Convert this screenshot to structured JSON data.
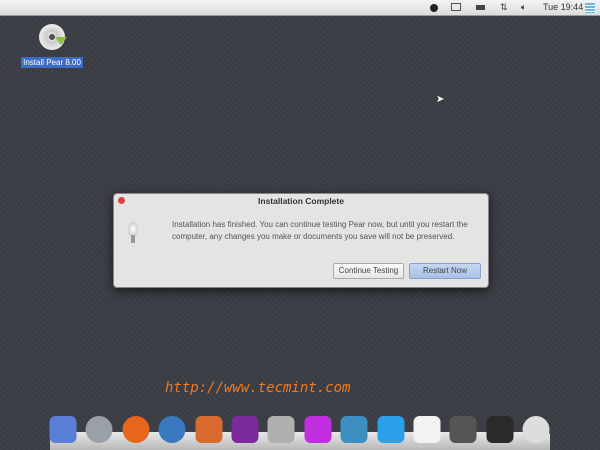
{
  "menubar": {
    "apple": "",
    "clock": "Tue 19:44",
    "icons": [
      "search-icon",
      "mail-icon",
      "battery-icon",
      "network-icon",
      "volume-icon",
      "list-icon"
    ]
  },
  "desktop": {
    "icon_label": "Install Pear 8.00"
  },
  "dialog": {
    "title": "Installation Complete",
    "message": "Installation has finished.  You can continue testing Pear now, but until you restart the computer, any changes you make or documents you save will not be preserved.",
    "continue_label": "Continue Testing",
    "restart_label": "Restart Now"
  },
  "watermark": "http://www.tecmint.com",
  "dock": [
    {
      "name": "finder",
      "color": "#5a7fd6"
    },
    {
      "name": "launchpad",
      "color": "#9aa0a8"
    },
    {
      "name": "firefox",
      "color": "#e8651c"
    },
    {
      "name": "thunderbird",
      "color": "#3a78c0"
    },
    {
      "name": "photos",
      "color": "#d86a30"
    },
    {
      "name": "music",
      "color": "#7a2a9a"
    },
    {
      "name": "contacts",
      "color": "#b0b0b0"
    },
    {
      "name": "cloud",
      "color": "#c12ee0"
    },
    {
      "name": "app-store",
      "color": "#3d8fc2"
    },
    {
      "name": "display",
      "color": "#29a0e8"
    },
    {
      "name": "settings-toggle",
      "color": "#f2f2f2"
    },
    {
      "name": "system-tools",
      "color": "#555555"
    },
    {
      "name": "trash",
      "color": "#2a2a2a"
    },
    {
      "name": "installer-disc",
      "color": "#dddddd"
    }
  ]
}
